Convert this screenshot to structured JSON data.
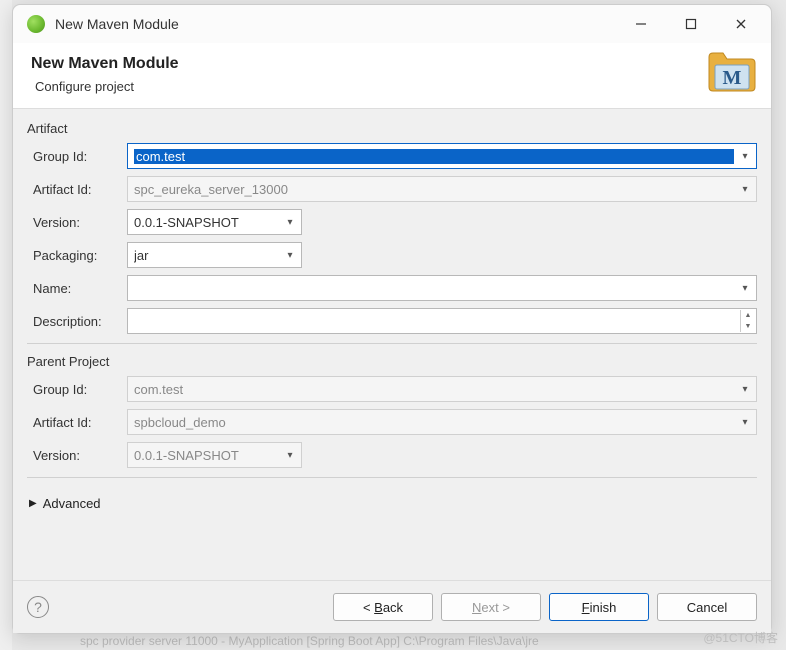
{
  "window": {
    "title": "New Maven Module"
  },
  "banner": {
    "heading": "New Maven Module",
    "subtitle": "Configure project"
  },
  "artifact": {
    "section_label": "Artifact",
    "group_id_label": "Group Id:",
    "group_id_value": "com.test",
    "artifact_id_label": "Artifact Id:",
    "artifact_id_value": "spc_eureka_server_13000",
    "version_label": "Version:",
    "version_value": "0.0.1-SNAPSHOT",
    "packaging_label": "Packaging:",
    "packaging_value": "jar",
    "name_label": "Name:",
    "name_value": "",
    "description_label": "Description:",
    "description_value": ""
  },
  "parent": {
    "section_label": "Parent Project",
    "group_id_label": "Group Id:",
    "group_id_value": "com.test",
    "artifact_id_label": "Artifact Id:",
    "artifact_id_value": "spbcloud_demo",
    "version_label": "Version:",
    "version_value": "0.0.1-SNAPSHOT"
  },
  "advanced_label": "Advanced",
  "buttons": {
    "back": "< Back",
    "next": "Next >",
    "finish": "Finish",
    "cancel": "Cancel"
  },
  "watermark": "@51CTO博客",
  "bg_status": "spc provider server 11000 - MyApplication [Spring Boot App] C:\\Program Files\\Java\\jre"
}
